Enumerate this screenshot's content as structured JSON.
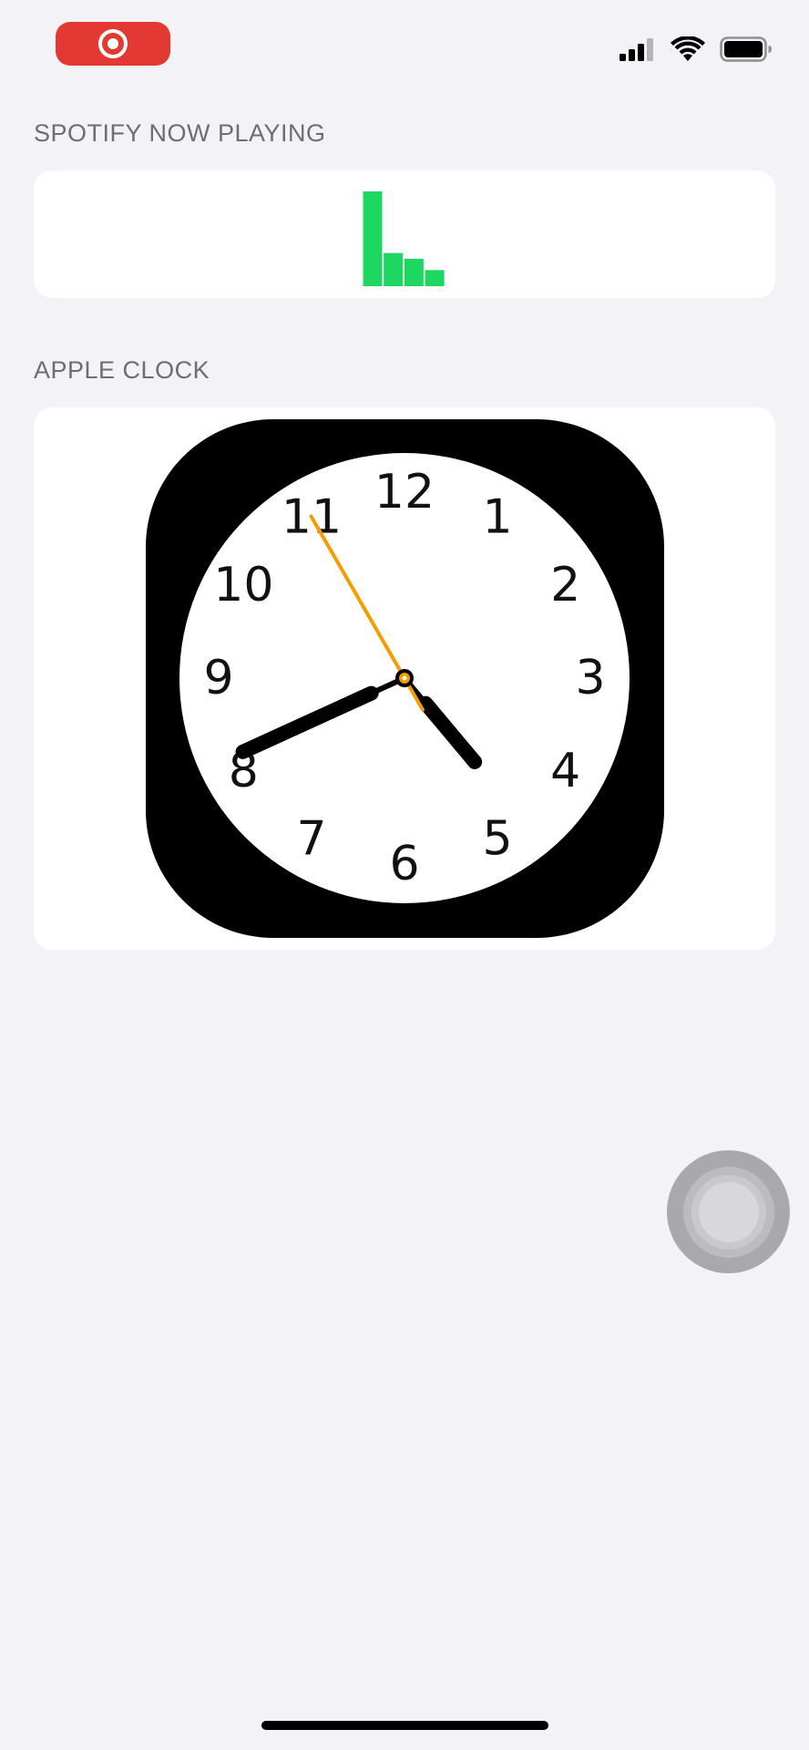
{
  "status_bar": {
    "record_icon": "screen-recording-icon",
    "signal_icon": "cellular-signal-icon",
    "wifi_icon": "wifi-icon",
    "battery_icon": "battery-icon"
  },
  "sections": {
    "spotify": {
      "label": "SPOTIFY NOW PLAYING",
      "accent_color": "#1ed760",
      "visualizer_levels": [
        1.0,
        0.35,
        0.29,
        0.17
      ]
    },
    "clock": {
      "label": "APPLE CLOCK",
      "numerals": [
        "12",
        "1",
        "2",
        "3",
        "4",
        "5",
        "6",
        "7",
        "8",
        "9",
        "10",
        "11"
      ],
      "time": {
        "hour": 4,
        "minute": 40,
        "second": 55
      },
      "second_hand_color": "#f59c00"
    }
  },
  "assistive_touch": {
    "icon": "assistive-touch-icon"
  }
}
